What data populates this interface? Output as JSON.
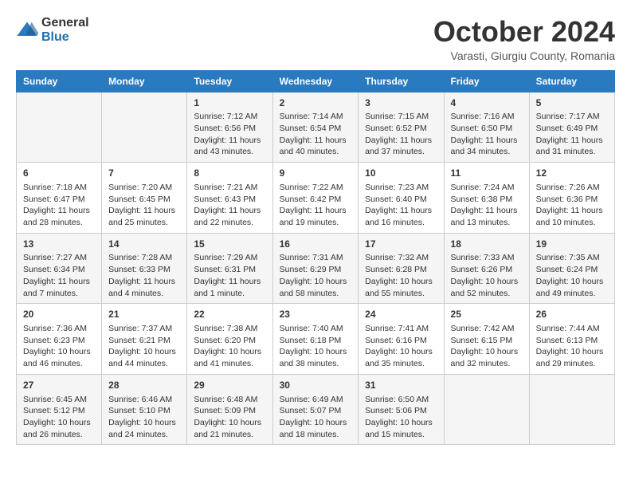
{
  "logo": {
    "general": "General",
    "blue": "Blue"
  },
  "title": "October 2024",
  "location": "Varasti, Giurgiu County, Romania",
  "days_of_week": [
    "Sunday",
    "Monday",
    "Tuesday",
    "Wednesday",
    "Thursday",
    "Friday",
    "Saturday"
  ],
  "weeks": [
    [
      {
        "day": "",
        "content": ""
      },
      {
        "day": "",
        "content": ""
      },
      {
        "day": "1",
        "content": "Sunrise: 7:12 AM\nSunset: 6:56 PM\nDaylight: 11 hours and 43 minutes."
      },
      {
        "day": "2",
        "content": "Sunrise: 7:14 AM\nSunset: 6:54 PM\nDaylight: 11 hours and 40 minutes."
      },
      {
        "day": "3",
        "content": "Sunrise: 7:15 AM\nSunset: 6:52 PM\nDaylight: 11 hours and 37 minutes."
      },
      {
        "day": "4",
        "content": "Sunrise: 7:16 AM\nSunset: 6:50 PM\nDaylight: 11 hours and 34 minutes."
      },
      {
        "day": "5",
        "content": "Sunrise: 7:17 AM\nSunset: 6:49 PM\nDaylight: 11 hours and 31 minutes."
      }
    ],
    [
      {
        "day": "6",
        "content": "Sunrise: 7:18 AM\nSunset: 6:47 PM\nDaylight: 11 hours and 28 minutes."
      },
      {
        "day": "7",
        "content": "Sunrise: 7:20 AM\nSunset: 6:45 PM\nDaylight: 11 hours and 25 minutes."
      },
      {
        "day": "8",
        "content": "Sunrise: 7:21 AM\nSunset: 6:43 PM\nDaylight: 11 hours and 22 minutes."
      },
      {
        "day": "9",
        "content": "Sunrise: 7:22 AM\nSunset: 6:42 PM\nDaylight: 11 hours and 19 minutes."
      },
      {
        "day": "10",
        "content": "Sunrise: 7:23 AM\nSunset: 6:40 PM\nDaylight: 11 hours and 16 minutes."
      },
      {
        "day": "11",
        "content": "Sunrise: 7:24 AM\nSunset: 6:38 PM\nDaylight: 11 hours and 13 minutes."
      },
      {
        "day": "12",
        "content": "Sunrise: 7:26 AM\nSunset: 6:36 PM\nDaylight: 11 hours and 10 minutes."
      }
    ],
    [
      {
        "day": "13",
        "content": "Sunrise: 7:27 AM\nSunset: 6:34 PM\nDaylight: 11 hours and 7 minutes."
      },
      {
        "day": "14",
        "content": "Sunrise: 7:28 AM\nSunset: 6:33 PM\nDaylight: 11 hours and 4 minutes."
      },
      {
        "day": "15",
        "content": "Sunrise: 7:29 AM\nSunset: 6:31 PM\nDaylight: 11 hours and 1 minute."
      },
      {
        "day": "16",
        "content": "Sunrise: 7:31 AM\nSunset: 6:29 PM\nDaylight: 10 hours and 58 minutes."
      },
      {
        "day": "17",
        "content": "Sunrise: 7:32 AM\nSunset: 6:28 PM\nDaylight: 10 hours and 55 minutes."
      },
      {
        "day": "18",
        "content": "Sunrise: 7:33 AM\nSunset: 6:26 PM\nDaylight: 10 hours and 52 minutes."
      },
      {
        "day": "19",
        "content": "Sunrise: 7:35 AM\nSunset: 6:24 PM\nDaylight: 10 hours and 49 minutes."
      }
    ],
    [
      {
        "day": "20",
        "content": "Sunrise: 7:36 AM\nSunset: 6:23 PM\nDaylight: 10 hours and 46 minutes."
      },
      {
        "day": "21",
        "content": "Sunrise: 7:37 AM\nSunset: 6:21 PM\nDaylight: 10 hours and 44 minutes."
      },
      {
        "day": "22",
        "content": "Sunrise: 7:38 AM\nSunset: 6:20 PM\nDaylight: 10 hours and 41 minutes."
      },
      {
        "day": "23",
        "content": "Sunrise: 7:40 AM\nSunset: 6:18 PM\nDaylight: 10 hours and 38 minutes."
      },
      {
        "day": "24",
        "content": "Sunrise: 7:41 AM\nSunset: 6:16 PM\nDaylight: 10 hours and 35 minutes."
      },
      {
        "day": "25",
        "content": "Sunrise: 7:42 AM\nSunset: 6:15 PM\nDaylight: 10 hours and 32 minutes."
      },
      {
        "day": "26",
        "content": "Sunrise: 7:44 AM\nSunset: 6:13 PM\nDaylight: 10 hours and 29 minutes."
      }
    ],
    [
      {
        "day": "27",
        "content": "Sunrise: 6:45 AM\nSunset: 5:12 PM\nDaylight: 10 hours and 26 minutes."
      },
      {
        "day": "28",
        "content": "Sunrise: 6:46 AM\nSunset: 5:10 PM\nDaylight: 10 hours and 24 minutes."
      },
      {
        "day": "29",
        "content": "Sunrise: 6:48 AM\nSunset: 5:09 PM\nDaylight: 10 hours and 21 minutes."
      },
      {
        "day": "30",
        "content": "Sunrise: 6:49 AM\nSunset: 5:07 PM\nDaylight: 10 hours and 18 minutes."
      },
      {
        "day": "31",
        "content": "Sunrise: 6:50 AM\nSunset: 5:06 PM\nDaylight: 10 hours and 15 minutes."
      },
      {
        "day": "",
        "content": ""
      },
      {
        "day": "",
        "content": ""
      }
    ]
  ]
}
